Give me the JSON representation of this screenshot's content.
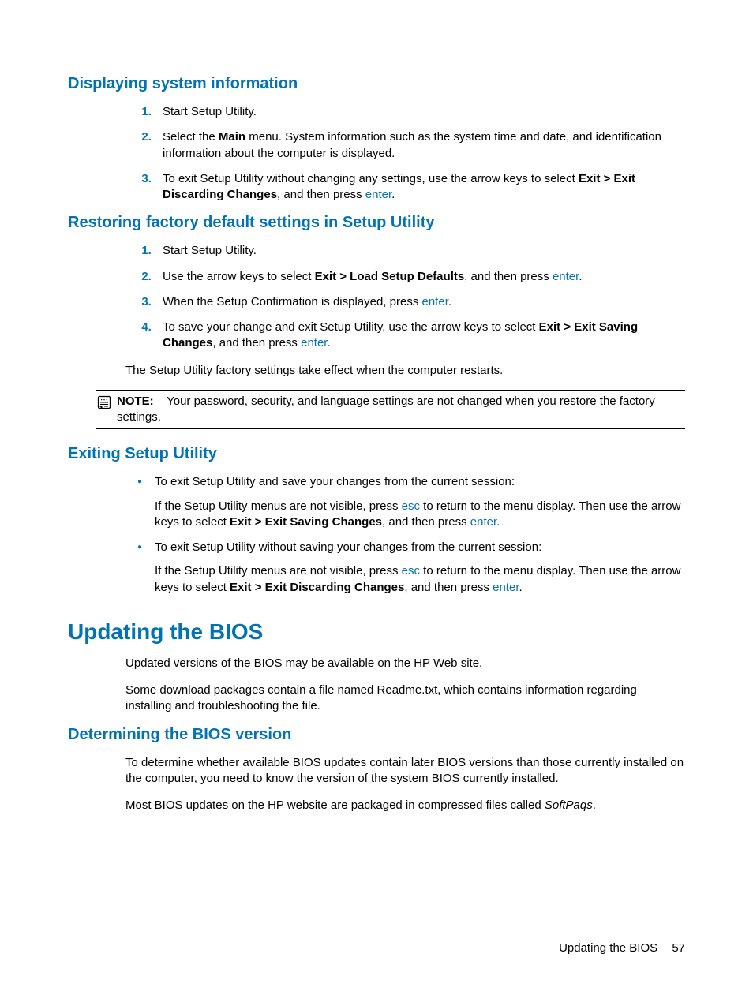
{
  "section1": {
    "heading": "Displaying system information",
    "items": [
      {
        "parts": [
          {
            "t": "Start Setup Utility."
          }
        ]
      },
      {
        "parts": [
          {
            "t": "Select the "
          },
          {
            "t": "Main",
            "bold": true
          },
          {
            "t": " menu. System information such as the system time and date, and identification information about the computer is displayed."
          }
        ]
      },
      {
        "parts": [
          {
            "t": "To exit Setup Utility without changing any settings, use the arrow keys to select "
          },
          {
            "t": "Exit > Exit Discarding Changes",
            "bold": true
          },
          {
            "t": ", and then press "
          },
          {
            "t": "enter",
            "key": true
          },
          {
            "t": "."
          }
        ]
      }
    ]
  },
  "section2": {
    "heading": "Restoring factory default settings in Setup Utility",
    "items": [
      {
        "parts": [
          {
            "t": "Start Setup Utility."
          }
        ]
      },
      {
        "parts": [
          {
            "t": "Use the arrow keys to select "
          },
          {
            "t": "Exit > Load Setup Defaults",
            "bold": true
          },
          {
            "t": ", and then press "
          },
          {
            "t": "enter",
            "key": true
          },
          {
            "t": "."
          }
        ]
      },
      {
        "parts": [
          {
            "t": "When the Setup Confirmation is displayed, press "
          },
          {
            "t": "enter",
            "key": true
          },
          {
            "t": "."
          }
        ]
      },
      {
        "parts": [
          {
            "t": "To save your change and exit Setup Utility, use the arrow keys to select "
          },
          {
            "t": "Exit > Exit Saving Changes",
            "bold": true
          },
          {
            "t": ", and then press "
          },
          {
            "t": "enter",
            "key": true
          },
          {
            "t": "."
          }
        ]
      }
    ],
    "afterText": "The Setup Utility factory settings take effect when the computer restarts.",
    "note": {
      "label": "NOTE:",
      "text": "Your password, security, and language settings are not changed when you restore the factory settings."
    }
  },
  "section3": {
    "heading": "Exiting Setup Utility",
    "bullets": [
      {
        "main": [
          {
            "t": "To exit Setup Utility and save your changes from the current session:"
          }
        ],
        "sub": [
          {
            "t": "If the Setup Utility menus are not visible, press "
          },
          {
            "t": "esc",
            "key": true
          },
          {
            "t": " to return to the menu display. Then use the arrow keys to select "
          },
          {
            "t": "Exit > Exit Saving Changes",
            "bold": true
          },
          {
            "t": ", and then press "
          },
          {
            "t": "enter",
            "key": true
          },
          {
            "t": "."
          }
        ]
      },
      {
        "main": [
          {
            "t": "To exit Setup Utility without saving your changes from the current session:"
          }
        ],
        "sub": [
          {
            "t": "If the Setup Utility menus are not visible, press "
          },
          {
            "t": "esc",
            "key": true
          },
          {
            "t": " to return to the menu display. Then use the arrow keys to select "
          },
          {
            "t": "Exit > Exit Discarding Changes",
            "bold": true
          },
          {
            "t": ", and then press "
          },
          {
            "t": "enter",
            "key": true
          },
          {
            "t": "."
          }
        ]
      }
    ]
  },
  "section4": {
    "heading": "Updating the BIOS",
    "paras": [
      [
        {
          "t": "Updated versions of the BIOS may be available on the HP Web site."
        }
      ],
      [
        {
          "t": "Some download packages contain a file named Readme.txt, which contains information regarding installing and troubleshooting the file."
        }
      ]
    ]
  },
  "section5": {
    "heading": "Determining the BIOS version",
    "paras": [
      [
        {
          "t": "To determine whether available BIOS updates contain later BIOS versions than those currently installed on the computer, you need to know the version of the system BIOS currently installed."
        }
      ],
      [
        {
          "t": "Most BIOS updates on the HP website are packaged in compressed files called "
        },
        {
          "t": "SoftPaqs",
          "italic": true
        },
        {
          "t": "."
        }
      ]
    ]
  },
  "footer": {
    "text": "Updating the BIOS",
    "page": "57"
  }
}
